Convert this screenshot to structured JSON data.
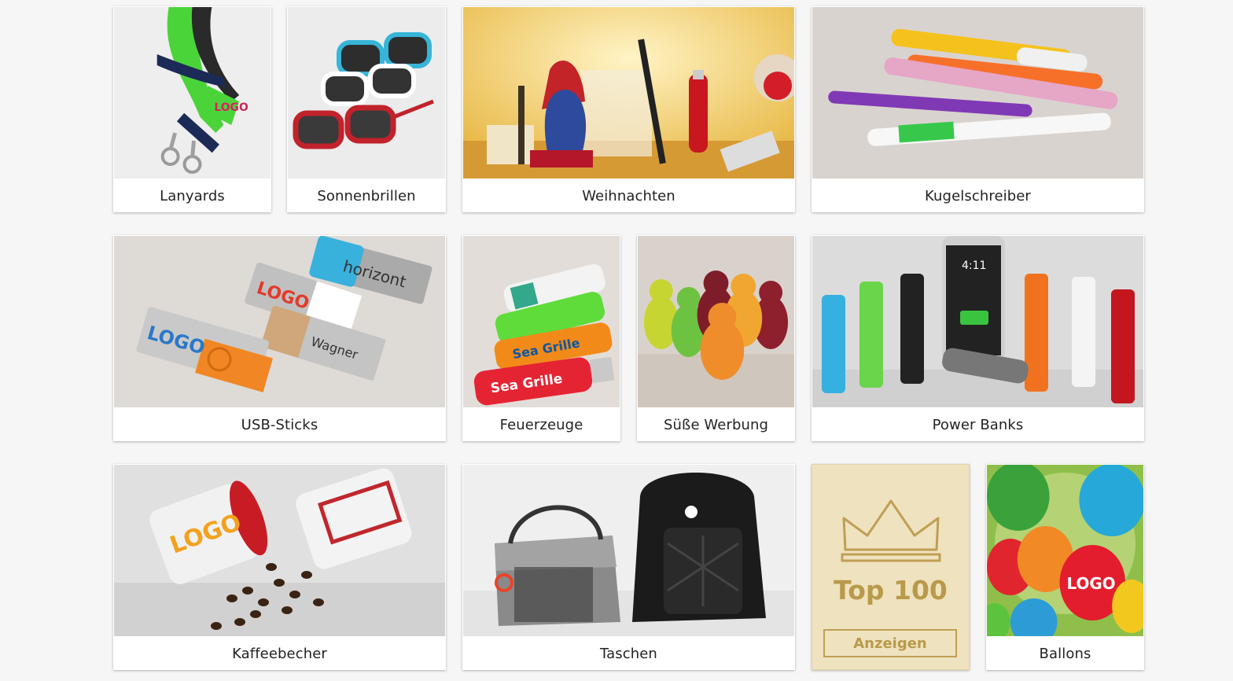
{
  "categories": [
    {
      "label": "Lanyards"
    },
    {
      "label": "Sonnenbrillen"
    },
    {
      "label": "Weihnachten"
    },
    {
      "label": "Kugelschreiber"
    },
    {
      "label": "USB-Sticks"
    },
    {
      "label": "Feuerzeuge"
    },
    {
      "label": "Süße Werbung"
    },
    {
      "label": "Power Banks"
    },
    {
      "label": "Kaffeebecher"
    },
    {
      "label": "Taschen"
    },
    {
      "label": "Ballons"
    }
  ],
  "top100": {
    "title": "Top 100",
    "button_label": "Anzeigen"
  },
  "image_text": {
    "usb_logo": "LOGO",
    "usb_logo_2": "LOGO",
    "usb_horizont": "horizont",
    "usb_wagner": "Wagner",
    "lighter_1": "Sea Grille",
    "lighter_2": "Sea Grille",
    "lanyard_logo": "LOGO",
    "phone_time": "4:11",
    "balloon_logo": "LOGO",
    "mug_logo": "LOGO"
  },
  "colors": {
    "page_bg": "#f6f6f6",
    "tile_bg": "#ffffff",
    "top100_bg": "#efe2bf",
    "top100_gold": "#b99a4a"
  }
}
